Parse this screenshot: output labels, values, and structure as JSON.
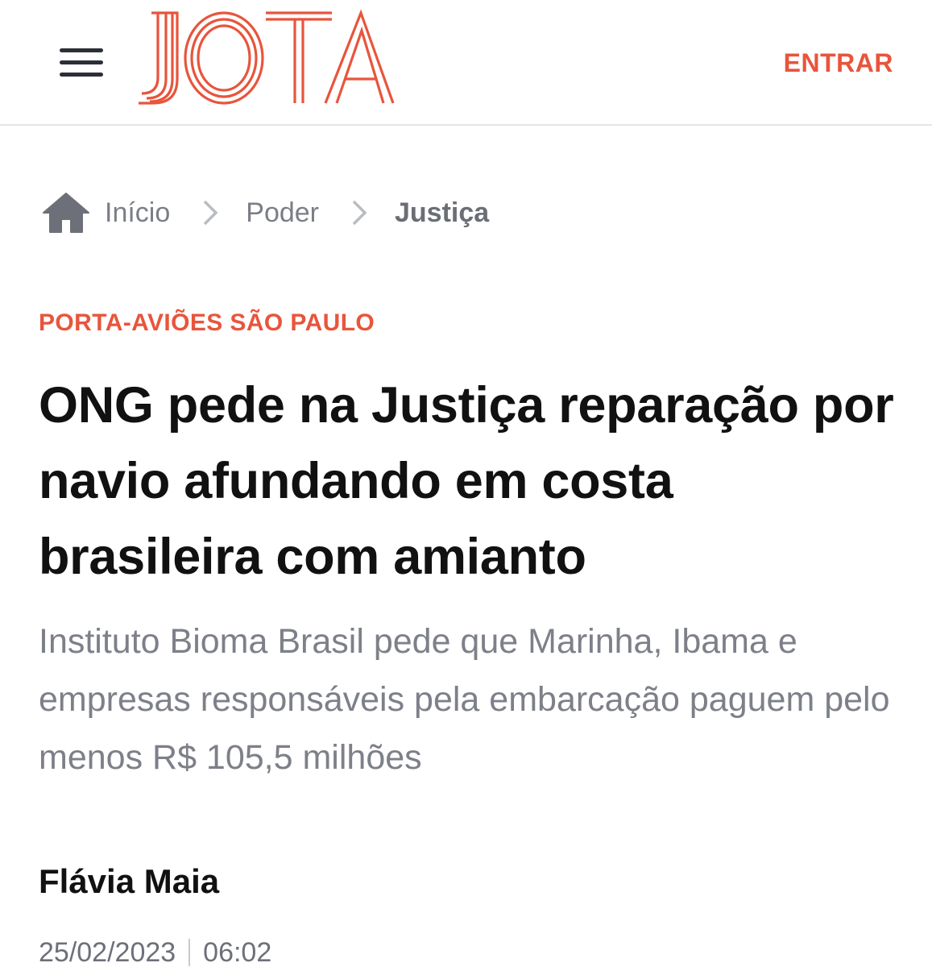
{
  "header": {
    "logo_text": "JOTA",
    "login_label": "ENTRAR",
    "brand_color": "#e8553c"
  },
  "breadcrumb": {
    "icon": "home-icon",
    "items": [
      {
        "label": "Início"
      },
      {
        "label": "Poder"
      },
      {
        "label": "Justiça"
      }
    ]
  },
  "article": {
    "kicker": "PORTA-AVIÕES SÃO PAULO",
    "title": "ONG pede na Justiça reparação por navio afundando em costa brasileira com amianto",
    "subtitle": "Instituto Bioma Brasil pede que Marinha, Ibama e empresas responsáveis pela embarcação paguem pelo menos R$ 105,5 milhões",
    "author": "Flávia Maia",
    "date": "25/02/2023",
    "time": "06:02"
  }
}
